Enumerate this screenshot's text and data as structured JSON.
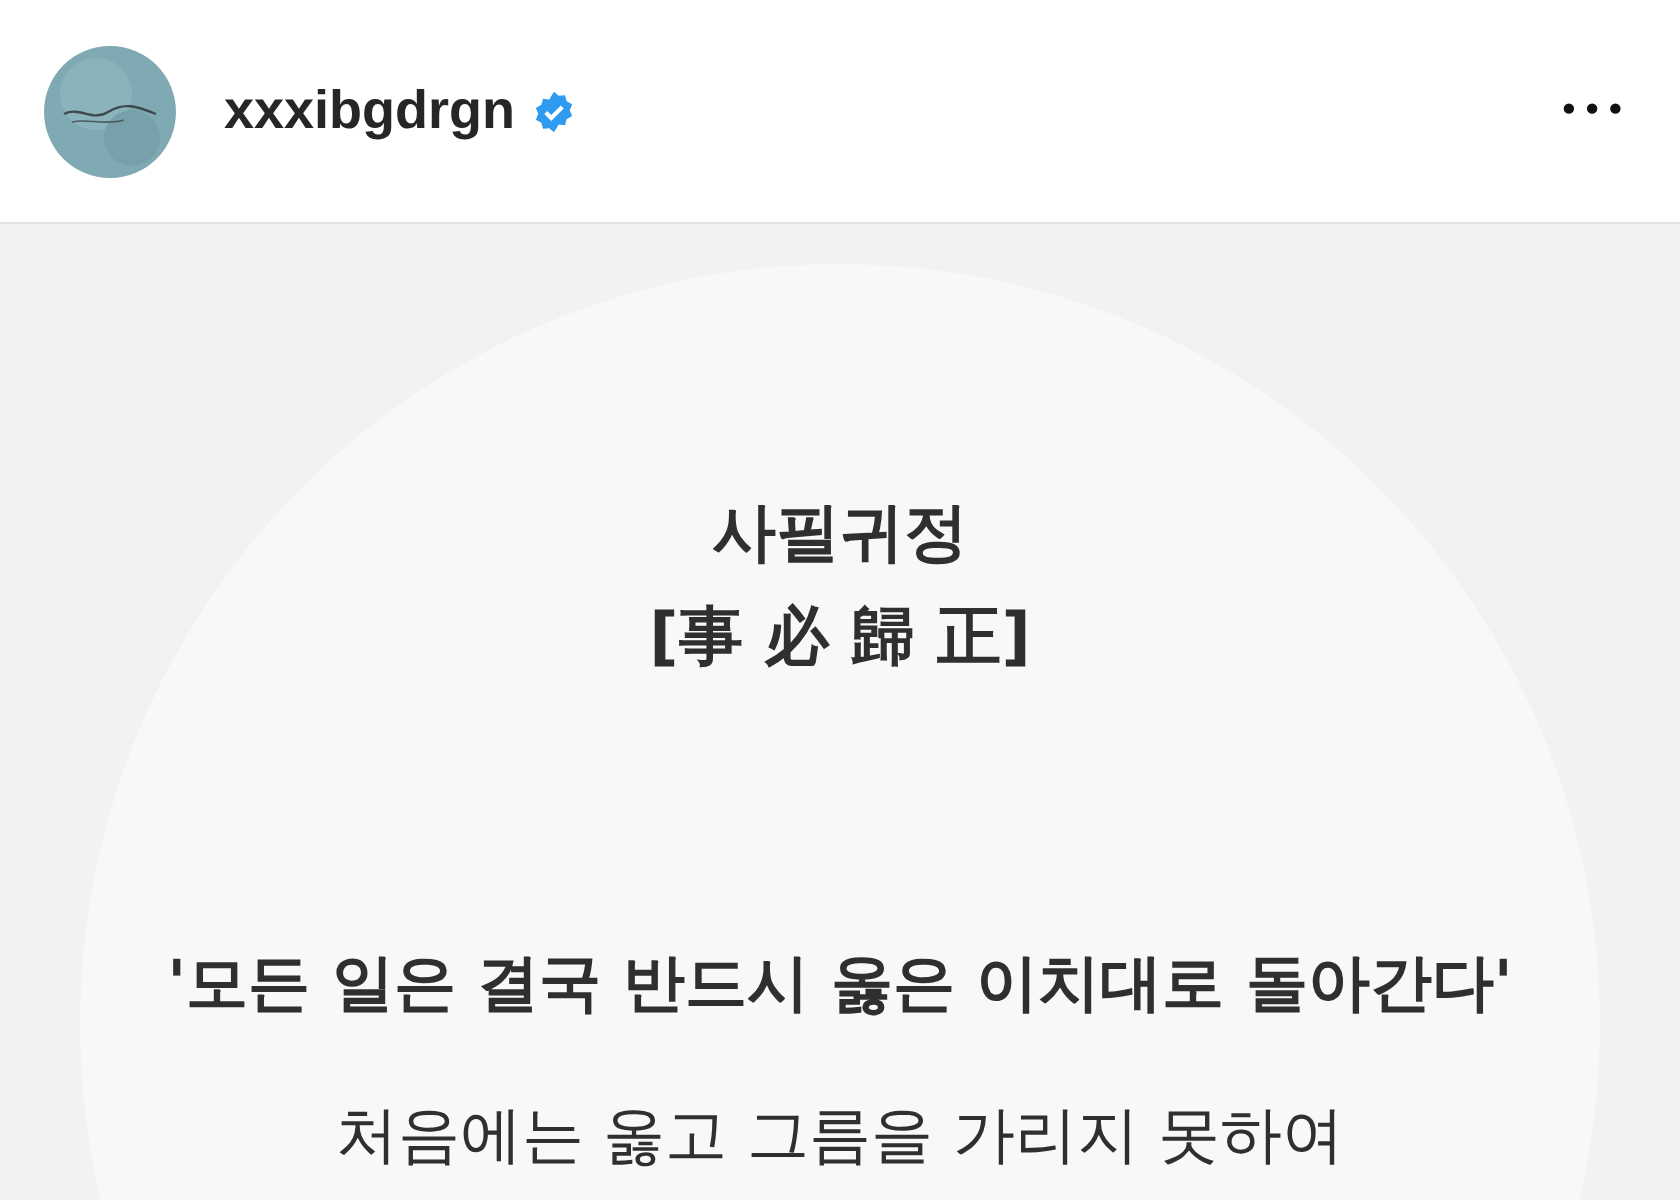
{
  "post_header": {
    "username": "xxxibgdrgn",
    "verified": true,
    "more_button": "•••"
  },
  "post_image": {
    "lines": [
      {
        "kind": "title",
        "text": "사필귀정"
      },
      {
        "kind": "title",
        "text": "[事 必 歸 正]"
      },
      {
        "kind": "quote",
        "text": "'모든 일은 결국 반드시 옳은 이치대로 돌아간다'"
      },
      {
        "kind": "body",
        "text": "처음에는 옳고 그름을 가리지 못하여"
      }
    ]
  }
}
